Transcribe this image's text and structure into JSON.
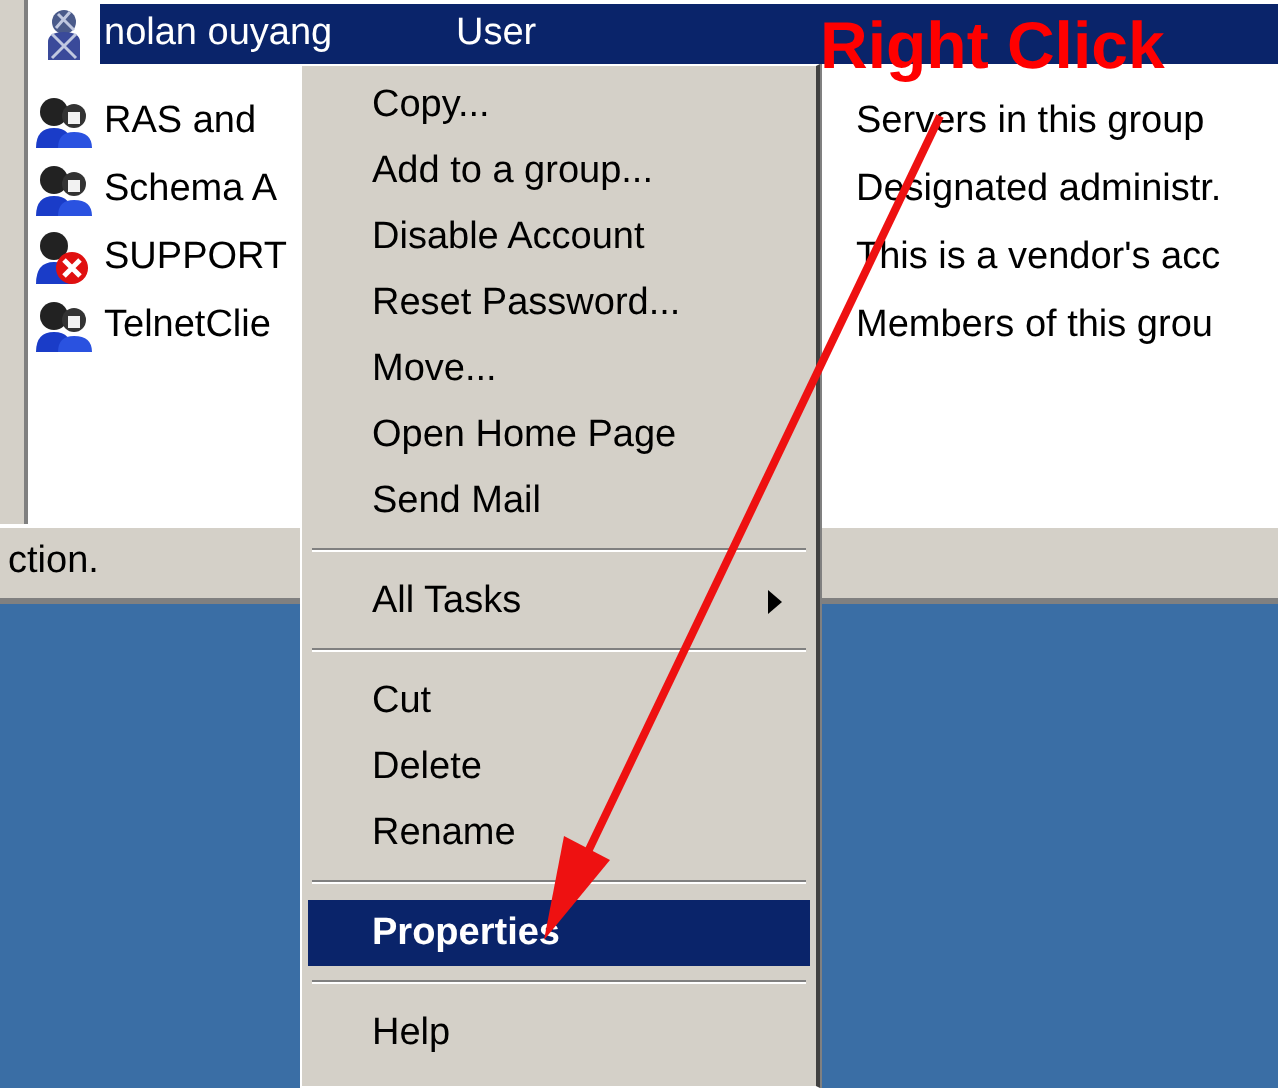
{
  "list": {
    "rows": [
      {
        "kind": "user",
        "name": "nolan ouyang",
        "column_2": "User",
        "selected": true
      },
      {
        "kind": "group",
        "name": "RAS and",
        "column_3": "Servers in this group",
        "selected": false
      },
      {
        "kind": "group",
        "name": "Schema A",
        "column_3": "Designated administr.",
        "selected": false
      },
      {
        "kind": "disabled_group",
        "name": "SUPPORT",
        "column_3": "This is a vendor's acc",
        "selected": false
      },
      {
        "kind": "group",
        "name": "TelnetClie",
        "column_3": "Members of this grou",
        "selected": false
      }
    ]
  },
  "status_bar": {
    "text": "ction."
  },
  "context_menu": {
    "items": [
      {
        "kind": "item",
        "label": "Copy...",
        "selected": false
      },
      {
        "kind": "item",
        "label": "Add to a group...",
        "selected": false
      },
      {
        "kind": "item",
        "label": "Disable Account",
        "selected": false
      },
      {
        "kind": "item",
        "label": "Reset Password...",
        "selected": false
      },
      {
        "kind": "item",
        "label": "Move...",
        "selected": false
      },
      {
        "kind": "item",
        "label": "Open Home Page",
        "selected": false
      },
      {
        "kind": "item",
        "label": "Send Mail",
        "selected": false
      },
      {
        "kind": "separator"
      },
      {
        "kind": "submenu",
        "label": "All Tasks",
        "selected": false
      },
      {
        "kind": "separator"
      },
      {
        "kind": "item",
        "label": "Cut",
        "selected": false
      },
      {
        "kind": "item",
        "label": "Delete",
        "selected": false
      },
      {
        "kind": "item",
        "label": "Rename",
        "selected": false
      },
      {
        "kind": "separator"
      },
      {
        "kind": "item",
        "label": "Properties",
        "selected": true
      },
      {
        "kind": "separator"
      },
      {
        "kind": "item",
        "label": "Help",
        "selected": false
      }
    ]
  },
  "annotation": {
    "text": "Right Click"
  }
}
